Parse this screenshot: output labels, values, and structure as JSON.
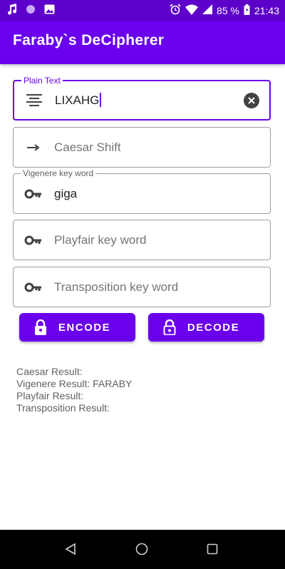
{
  "status_bar": {
    "battery": "85 %",
    "time": "21:43",
    "icons": [
      "music-note-icon",
      "circle-icon",
      "image-icon",
      "alarm-icon",
      "wifi-icon",
      "signal-icon",
      "battery-icon"
    ]
  },
  "app_bar": {
    "title": "Faraby`s DeCipherer"
  },
  "fields": {
    "plain_text": {
      "label": "Plain Text",
      "value": "LIXAHG",
      "icon": "text-lines-icon"
    },
    "caesar": {
      "placeholder": "Caesar Shift",
      "icon": "arrow-right-icon"
    },
    "vigenere": {
      "label": "Vigenere key word",
      "value": "giga",
      "icon": "key-icon"
    },
    "playfair": {
      "placeholder": "Playfair key word",
      "icon": "key-icon"
    },
    "transposition": {
      "placeholder": "Transposition key word",
      "icon": "key-icon"
    }
  },
  "buttons": {
    "encode": {
      "label": "ENCODE",
      "icon": "lock-icon"
    },
    "decode": {
      "label": "DECODE",
      "icon": "unlock-icon"
    }
  },
  "results": {
    "caesar": "Caesar Result:",
    "vigenere": "Vigenere Result: FARABY",
    "playfair": "Playfair Result:",
    "transposition": "Transposition Result:"
  },
  "colors": {
    "primary": "#6a00ee",
    "primary_dark": "#5d00c9"
  }
}
